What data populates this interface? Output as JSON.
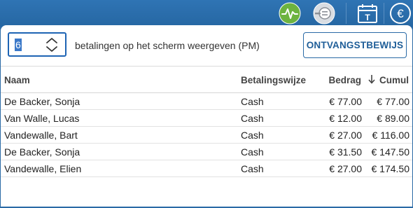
{
  "topbar": {
    "icons": [
      "activity-icon",
      "plug-icon",
      "calendar-icon",
      "euro-icon"
    ],
    "calendar_letter": "T",
    "euro_symbol": "€",
    "activity_color": "#6db33f"
  },
  "controls": {
    "count_value": "6",
    "count_label": "betalingen op het scherm weergeven (PM)",
    "receipt_button": "ONTVANGSTBEWIJS"
  },
  "table": {
    "columns": {
      "name": "Naam",
      "method": "Betalingswijze",
      "amount": "Bedrag",
      "cumul": "Cumul"
    },
    "rows": [
      {
        "name": "De Backer, Sonja",
        "method": "Cash",
        "amount": "€ 77.00",
        "cumul": "€ 77.00"
      },
      {
        "name": "Van Walle, Lucas",
        "method": "Cash",
        "amount": "€ 12.00",
        "cumul": "€ 89.00"
      },
      {
        "name": "Vandewalle, Bart",
        "method": "Cash",
        "amount": "€ 27.00",
        "cumul": "€ 116.00"
      },
      {
        "name": "De Backer, Sonja",
        "method": "Cash",
        "amount": "€ 31.50",
        "cumul": "€ 147.50"
      },
      {
        "name": "Vandewalle, Elien",
        "method": "Cash",
        "amount": "€ 27.00",
        "cumul": "€ 174.50"
      }
    ]
  },
  "colors": {
    "brand_blue": "#2a6aa6",
    "accent_green": "#6db33f"
  }
}
